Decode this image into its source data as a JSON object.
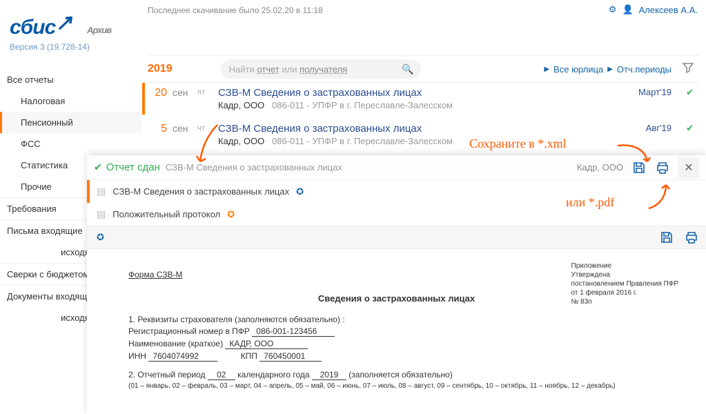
{
  "header": {
    "last_download": "Последнее скачивание было 25.02.20 в 11:18",
    "user_name": "Алексеев А.А."
  },
  "logo": {
    "text": "сбис",
    "sub": "Архив",
    "version": "Версия 3 (19.728-14)"
  },
  "sidebar": {
    "items": [
      {
        "label": "Все отчеты"
      },
      {
        "label": "Налоговая"
      },
      {
        "label": "Пенсионный"
      },
      {
        "label": "ФСС"
      },
      {
        "label": "Статистика"
      },
      {
        "label": "Прочие"
      }
    ],
    "tail": [
      {
        "label": "Требования"
      },
      {
        "label": "Письма входящие"
      },
      {
        "label": "исходящие"
      },
      {
        "label": "Сверки с бюджетом"
      },
      {
        "label": "Документы входящие"
      },
      {
        "label": "исходящие"
      }
    ]
  },
  "yearbar": {
    "year": "2019",
    "search_prefix": "Найти ",
    "search_link1": "отчет",
    "search_mid": " или ",
    "search_link2": "получателя",
    "link_all": "Все юрлица",
    "link_periods": "Отч.периоды"
  },
  "list": [
    {
      "day": "20",
      "mon": "сен",
      "dow": "пт",
      "title": "СЗВ-М Сведения о застрахованных лицах",
      "org": "Кадр, ООО",
      "reg": "086-011",
      "target": " - УПФР в г. Переславле-Залесском",
      "period": "Март'19"
    },
    {
      "day": "5",
      "mon": "сен",
      "dow": "чт",
      "title": "СЗВ-М Сведения о застрахованных лицах",
      "org": "Кадр, ООО",
      "reg": "086-011",
      "target": " - УПФР в г. Переславле-Залесском",
      "period": "Авг'19"
    }
  ],
  "panel": {
    "status": "Отчет сдан",
    "desc": "СЗВ-М Сведения о застрахованных лицах",
    "org": "Кадр, ООО",
    "close": "✕",
    "docs": [
      {
        "label": "СЗВ-М Сведения о застрахованных лицах"
      },
      {
        "label": "Положительный протокол"
      }
    ]
  },
  "doc": {
    "app0": "Приложение",
    "app1": "Утверждена",
    "app2": "постановлением Правления ПФР",
    "app3": "от 1 февраля 2016 г.",
    "app4": "№ 83п",
    "form": "Форма СЗВ-М",
    "title": "Сведения о застрахованных лицах",
    "s1": "1. Реквизиты страхователя (заполняются обязательно) :",
    "reg_lbl": "Регистрационный номер в ПФР",
    "reg_val": "086-001-123456",
    "name_lbl": "Наименование (краткое)",
    "name_val": "КАДР, ООО",
    "inn_lbl": "ИНН",
    "inn_val": "7604074992",
    "kpp_lbl": "КПП",
    "kpp_val": "760450001",
    "s2a": "2. Отчетный период",
    "s2_month": "02",
    "s2b": "календарного года",
    "s2_year": "2019",
    "s2c": "(заполняется обязательно)",
    "s2note": "(01 – январь, 02 – февраль, 03 – март, 04 – апрель, 05 – май, 06 – июнь, 07 – июль, 08 – август, 09 – сентябрь, 10 – октябрь, 11 – ноябрь, 12 – декабрь)"
  },
  "annot": {
    "a1": "Сохраните в *.xml",
    "a2": "или *.pdf"
  }
}
